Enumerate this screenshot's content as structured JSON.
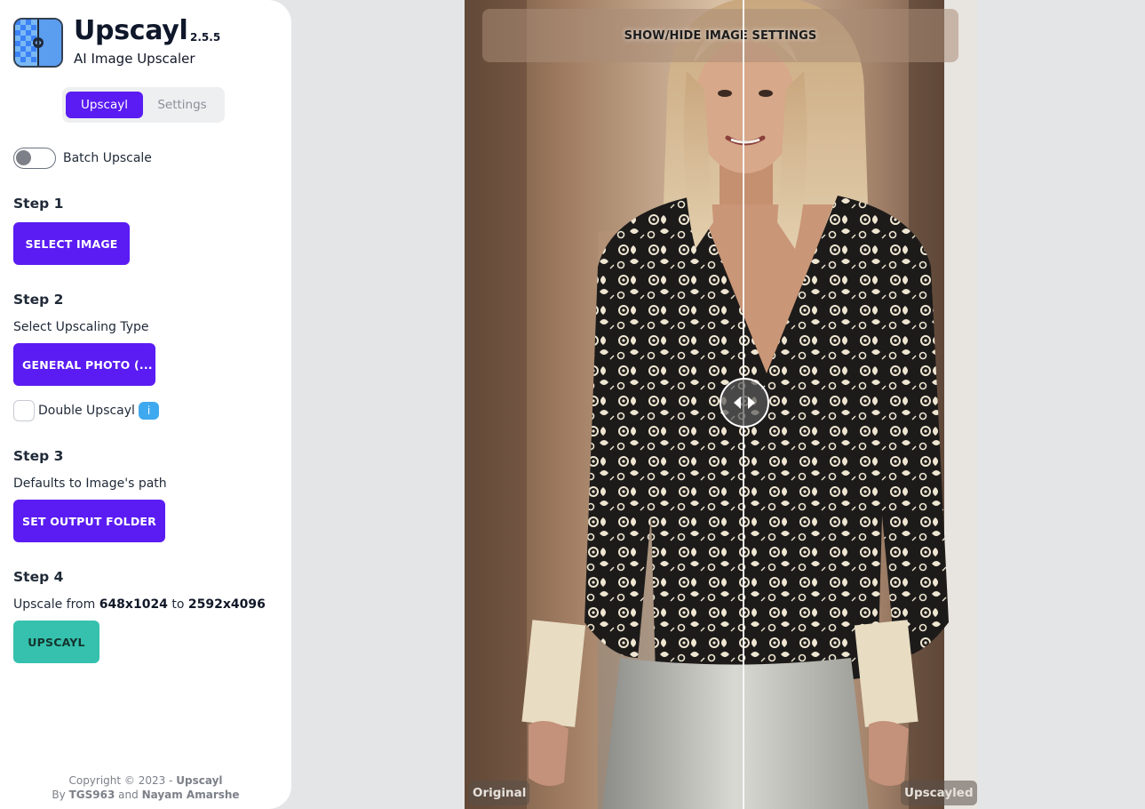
{
  "app": {
    "name": "Upscayl",
    "version": "2.5.5",
    "subtitle": "AI Image Upscaler",
    "logo_icon": "upscayl-logo-icon"
  },
  "tabs": [
    {
      "label": "Upscayl",
      "active": true
    },
    {
      "label": "Settings",
      "active": false
    }
  ],
  "batch": {
    "label": "Batch Upscale",
    "enabled": false
  },
  "step1": {
    "title": "Step 1",
    "button": "SELECT IMAGE"
  },
  "step2": {
    "title": "Step 2",
    "desc": "Select Upscaling Type",
    "button": "GENERAL PHOTO (...",
    "double_label": "Double Upscayl",
    "double_checked": false,
    "info_badge": "i"
  },
  "step3": {
    "title": "Step 3",
    "desc": "Defaults to Image's path",
    "button": "SET OUTPUT FOLDER"
  },
  "step4": {
    "title": "Step 4",
    "desc_prefix": "Upscale from",
    "from_res": "648x1024",
    "desc_mid": "to",
    "to_res": "2592x4096",
    "button": "UPSCAYL"
  },
  "footer": {
    "line1_prefix": "Copyright © 2023 -",
    "line1_brand": "Upscayl",
    "line2_by": "By",
    "author1": "TGS963",
    "line2_and": "and",
    "author2": "Nayam Amarshe"
  },
  "viewer": {
    "settings_toggle": "SHOW/HIDE IMAGE SETTINGS",
    "original_label": "Original",
    "upscayled_label": "Upscayled",
    "handle_icon": "compare-slider-arrows-icon",
    "slider_position": 0.545
  },
  "colors": {
    "accent": "#5a1cf2",
    "upscayl_button": "#35c1ad",
    "info": "#3fa9ef",
    "background": "#e4e5e6"
  }
}
